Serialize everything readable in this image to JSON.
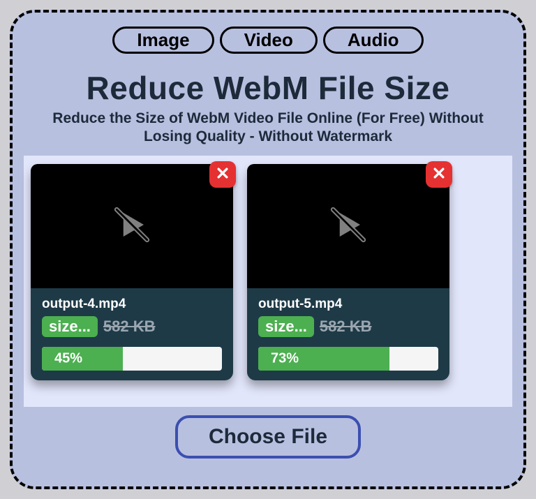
{
  "tabs": {
    "image": "Image",
    "video": "Video",
    "audio": "Audio"
  },
  "title": "Reduce WebM File Size",
  "subtitle": "Reduce the Size of WebM Video File Online (For Free) Without Losing Quality - Without Watermark",
  "files": [
    {
      "name": "output-4.mp4",
      "size_badge": "size...",
      "old_size": "582 KB",
      "progress": 45,
      "progress_label": "45%"
    },
    {
      "name": "output-5.mp4",
      "size_badge": "size...",
      "old_size": "582 KB",
      "progress": 73,
      "progress_label": "73%"
    }
  ],
  "choose_label": "Choose File"
}
